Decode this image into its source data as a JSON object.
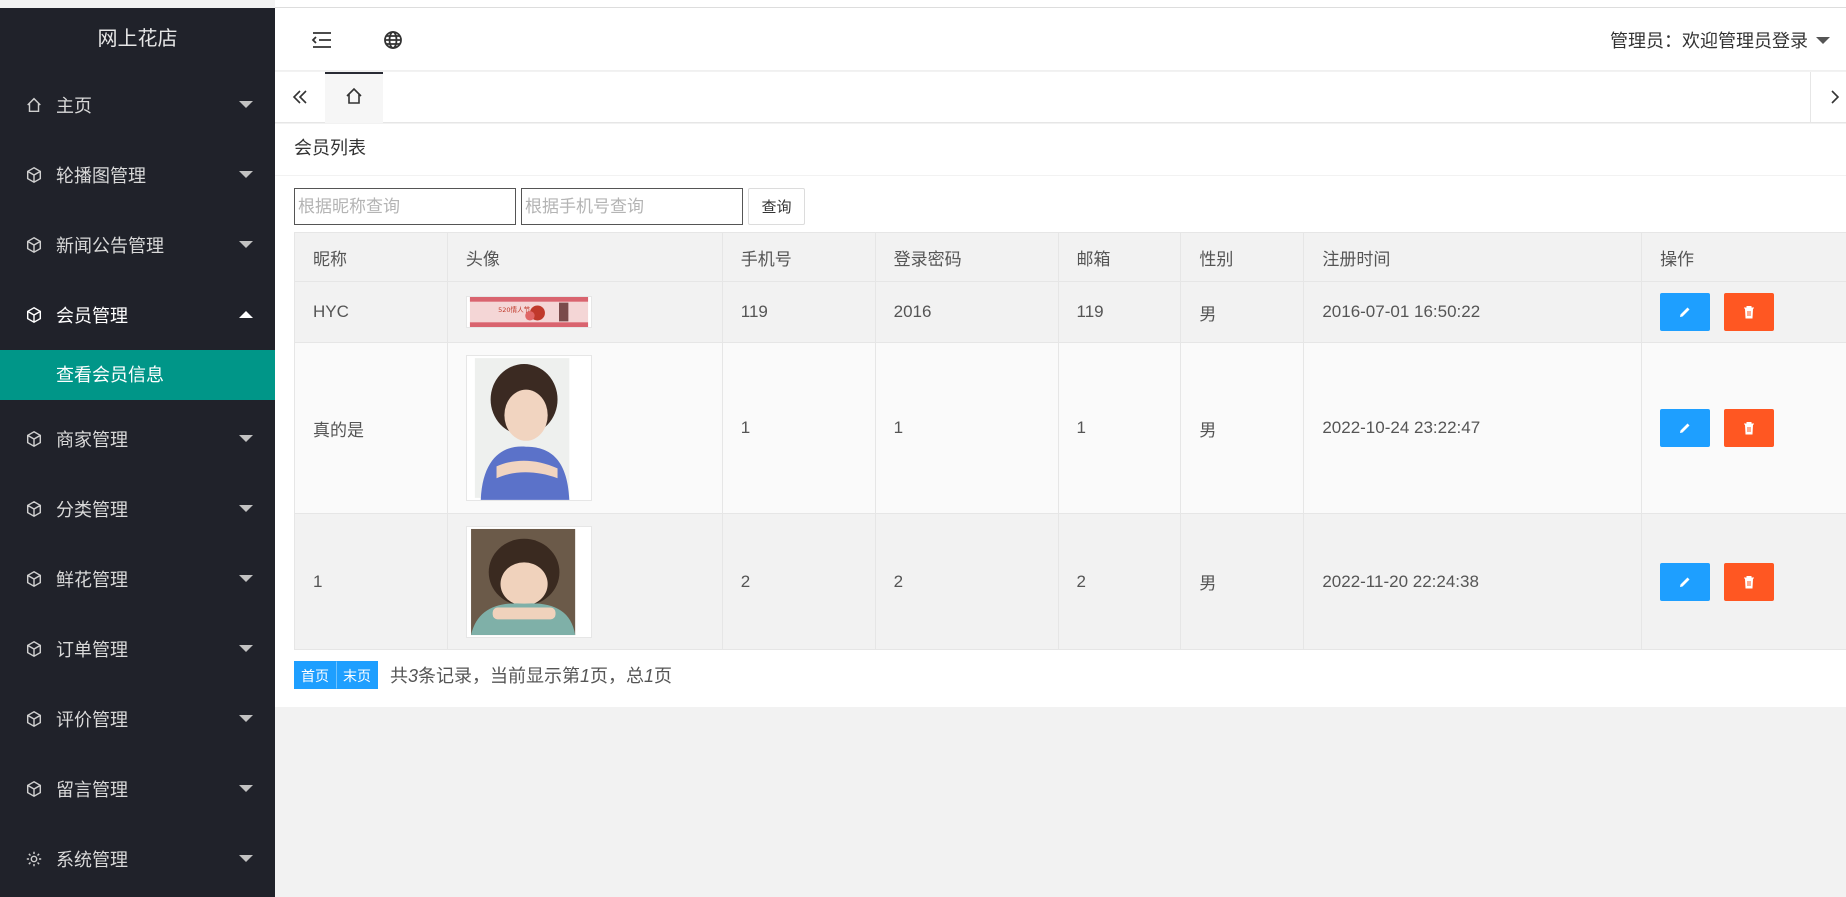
{
  "sidebar": {
    "brand": "网上花店",
    "items": [
      {
        "label": "主页",
        "icon": "home-icon"
      },
      {
        "label": "轮播图管理",
        "icon": "cube-icon"
      },
      {
        "label": "新闻公告管理",
        "icon": "cube-icon"
      },
      {
        "label": "会员管理",
        "icon": "cube-icon",
        "open": true
      },
      {
        "label": "商家管理",
        "icon": "cube-icon"
      },
      {
        "label": "分类管理",
        "icon": "cube-icon"
      },
      {
        "label": "鲜花管理",
        "icon": "cube-icon"
      },
      {
        "label": "订单管理",
        "icon": "cube-icon"
      },
      {
        "label": "评价管理",
        "icon": "cube-icon"
      },
      {
        "label": "留言管理",
        "icon": "cube-icon"
      },
      {
        "label": "系统管理",
        "icon": "gear-icon"
      }
    ],
    "sub_item": "查看会员信息"
  },
  "header": {
    "admin_text": "管理员：欢迎管理员登录"
  },
  "panel": {
    "title": "会员列表",
    "search": {
      "nickname_placeholder": "根据昵称查询",
      "phone_placeholder": "根据手机号查询",
      "button": "查询"
    },
    "columns": [
      "昵称",
      "头像",
      "手机号",
      "登录密码",
      "邮箱",
      "性别",
      "注册时间",
      "操作"
    ],
    "rows": [
      {
        "nickname": "HYC",
        "phone": "119",
        "password": "2016",
        "email": "119",
        "gender": "男",
        "time": "2016-07-01 16:50:22",
        "avatar": "banner-thumbnail",
        "banner_text": "520情人节"
      },
      {
        "nickname": "真的是",
        "phone": "1",
        "password": "1",
        "email": "1",
        "gender": "男",
        "time": "2022-10-24 23:22:47",
        "avatar": "child-photo"
      },
      {
        "nickname": "1",
        "phone": "2",
        "password": "2",
        "email": "2",
        "gender": "男",
        "time": "2022-11-20 22:24:38",
        "avatar": "child-photo"
      }
    ],
    "pager": {
      "first": "首页",
      "last": "末页",
      "info_pre": "共",
      "total": "3",
      "info_mid": "条记录，当前显示第",
      "page": "1",
      "info_mid2": "页，总",
      "pages": "1",
      "info_post": "页"
    }
  },
  "colors": {
    "sidebar_bg": "#20222a",
    "active_sub_bg": "#009688",
    "edit_btn": "#1e9fff",
    "delete_btn": "#ff5722",
    "pager_btn": "#1e9fff"
  }
}
